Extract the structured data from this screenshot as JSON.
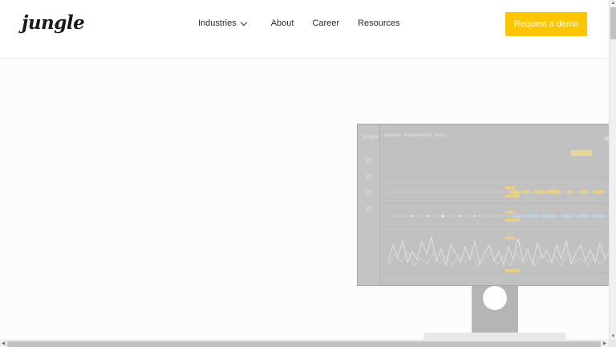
{
  "header": {
    "logo": "jungle",
    "nav": [
      {
        "label": "Industries",
        "has_dropdown": true
      },
      {
        "label": "About"
      },
      {
        "label": "Career"
      },
      {
        "label": "Resources"
      }
    ],
    "cta_label": "Request a demo"
  },
  "monitor": {
    "screen_logo": "jungle",
    "screen_title": "TURBINE PERFORMANCE MODEL"
  },
  "colors": {
    "accent": "#ffc600",
    "background": "#fcfcfc",
    "monitor": "#b9b9b9"
  },
  "icons": [
    "chevron-down-icon",
    "scroll-up-icon",
    "scroll-down-icon",
    "scroll-left-icon",
    "scroll-right-icon"
  ]
}
